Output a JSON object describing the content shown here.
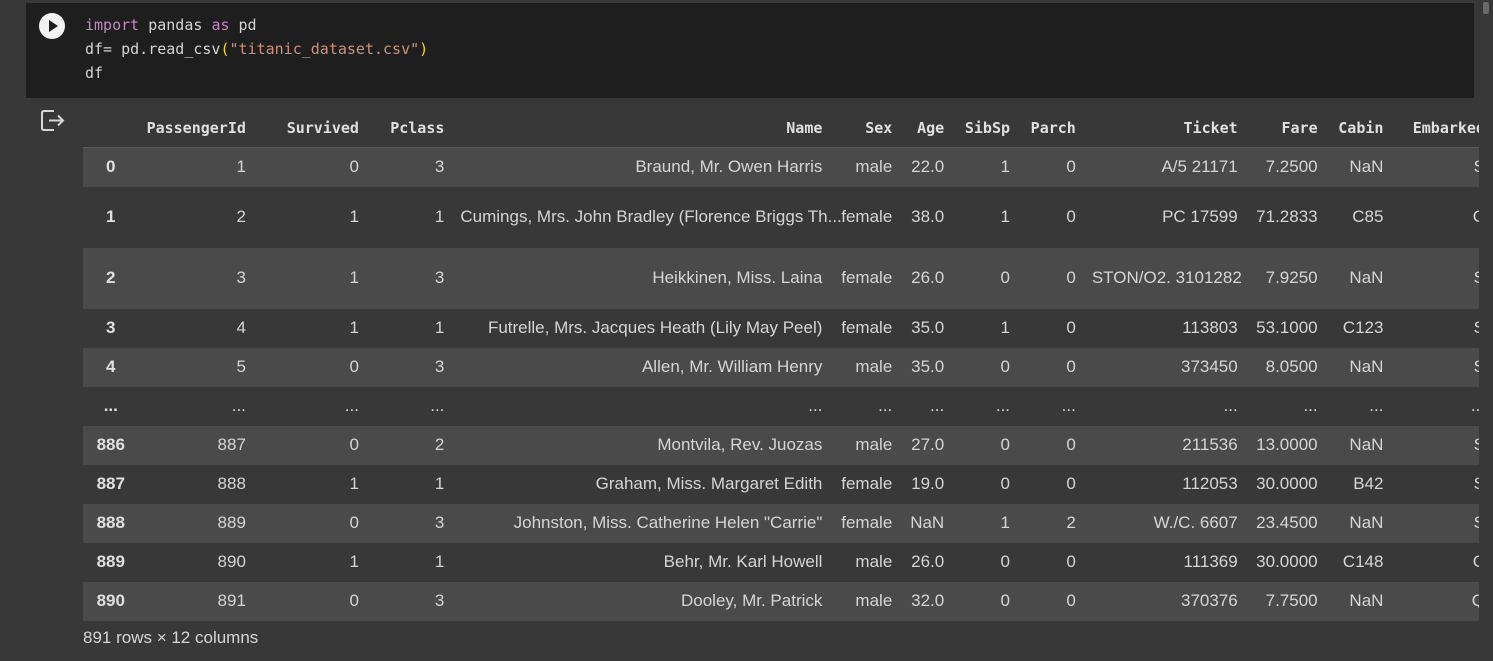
{
  "code": {
    "line1": {
      "kw1": "import",
      "mod": " pandas ",
      "kw2": "as",
      "alias": " pd"
    },
    "line2": {
      "pre": "df= pd.read_csv",
      "open": "(",
      "str": "\"titanic_dataset.csv\"",
      "close": ")"
    },
    "line3": "df"
  },
  "icons": {
    "run": "play-icon",
    "output": "output-exit-icon"
  },
  "table": {
    "columns": [
      "PassengerId",
      "Survived",
      "Pclass",
      "Name",
      "Sex",
      "Age",
      "SibSp",
      "Parch",
      "Ticket",
      "Fare",
      "Cabin",
      "Embarked"
    ],
    "rows": [
      {
        "index": "0",
        "cells": [
          "1",
          "0",
          "3",
          "Braund, Mr. Owen Harris",
          "male",
          "22.0",
          "1",
          "0",
          "A/5 21171",
          "7.2500",
          "NaN",
          "S"
        ]
      },
      {
        "index": "1",
        "cells": [
          "2",
          "1",
          "1",
          "Cumings, Mrs. John Bradley (Florence Briggs Th...",
          "female",
          "38.0",
          "1",
          "0",
          "PC 17599",
          "71.2833",
          "C85",
          "C"
        ]
      },
      {
        "index": "2",
        "cells": [
          "3",
          "1",
          "3",
          "Heikkinen, Miss. Laina",
          "female",
          "26.0",
          "0",
          "0",
          "STON/O2. 3101282",
          "7.9250",
          "NaN",
          "S"
        ]
      },
      {
        "index": "3",
        "cells": [
          "4",
          "1",
          "1",
          "Futrelle, Mrs. Jacques Heath (Lily May Peel)",
          "female",
          "35.0",
          "1",
          "0",
          "113803",
          "53.1000",
          "C123",
          "S"
        ]
      },
      {
        "index": "4",
        "cells": [
          "5",
          "0",
          "3",
          "Allen, Mr. William Henry",
          "male",
          "35.0",
          "0",
          "0",
          "373450",
          "8.0500",
          "NaN",
          "S"
        ]
      },
      {
        "index": "...",
        "cells": [
          "...",
          "...",
          "...",
          "...",
          "...",
          "...",
          "...",
          "...",
          "...",
          "...",
          "...",
          "..."
        ]
      },
      {
        "index": "886",
        "cells": [
          "887",
          "0",
          "2",
          "Montvila, Rev. Juozas",
          "male",
          "27.0",
          "0",
          "0",
          "211536",
          "13.0000",
          "NaN",
          "S"
        ]
      },
      {
        "index": "887",
        "cells": [
          "888",
          "1",
          "1",
          "Graham, Miss. Margaret Edith",
          "female",
          "19.0",
          "0",
          "0",
          "112053",
          "30.0000",
          "B42",
          "S"
        ]
      },
      {
        "index": "888",
        "cells": [
          "889",
          "0",
          "3",
          "Johnston, Miss. Catherine Helen \"Carrie\"",
          "female",
          "NaN",
          "1",
          "2",
          "W./C. 6607",
          "23.4500",
          "NaN",
          "S"
        ]
      },
      {
        "index": "889",
        "cells": [
          "890",
          "1",
          "1",
          "Behr, Mr. Karl Howell",
          "male",
          "26.0",
          "0",
          "0",
          "111369",
          "30.0000",
          "C148",
          "C"
        ]
      },
      {
        "index": "890",
        "cells": [
          "891",
          "0",
          "3",
          "Dooley, Mr. Patrick",
          "male",
          "32.0",
          "0",
          "0",
          "370376",
          "7.7500",
          "NaN",
          "Q"
        ]
      }
    ],
    "footer": "891 rows × 12 columns"
  }
}
